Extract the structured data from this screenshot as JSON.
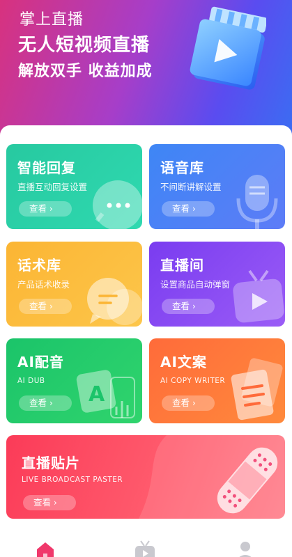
{
  "hero": {
    "line1": "掌上直播",
    "line2": "无人短视频直播",
    "line3": "解放双手 收益加成",
    "art_icon": "video-play-card-icon"
  },
  "cards": [
    {
      "title": "智能回复",
      "subtitle": "直播互动回复设置",
      "button": "查看",
      "icon": "chat-bubble-icon",
      "color": "#27c9a0"
    },
    {
      "title": "语音库",
      "subtitle": "不间断讲解设置",
      "button": "查看",
      "icon": "microphone-icon",
      "color": "#3e86f5"
    },
    {
      "title": "话术库",
      "subtitle": "产品话术收录",
      "button": "查看",
      "icon": "speech-bubbles-icon",
      "color": "#fbb534"
    },
    {
      "title": "直播间",
      "subtitle": "设置商品自动弹窗",
      "button": "查看",
      "icon": "tv-play-icon",
      "color": "#7a3cf0"
    },
    {
      "title": "AI配音",
      "subtitle": "AI DUB",
      "button": "查看",
      "icon": "ai-voice-icon",
      "color": "#1bc46a"
    },
    {
      "title": "AI文案",
      "subtitle": "AI COPY WRITER",
      "button": "查看",
      "icon": "document-icon",
      "color": "#ff6b3a"
    }
  ],
  "wide_card": {
    "title": "直播贴片",
    "subtitle": "LIVE BROADCAST PASTER",
    "button": "查看",
    "icon": "bandage-icon",
    "color": "#fb3b58"
  },
  "tabbar": [
    {
      "icon": "home-icon",
      "active": true,
      "color": "#f0386b"
    },
    {
      "icon": "tv-icon",
      "active": false,
      "color": "#c9c9cf"
    },
    {
      "icon": "user-icon",
      "active": false,
      "color": "#c9c9cf"
    }
  ]
}
